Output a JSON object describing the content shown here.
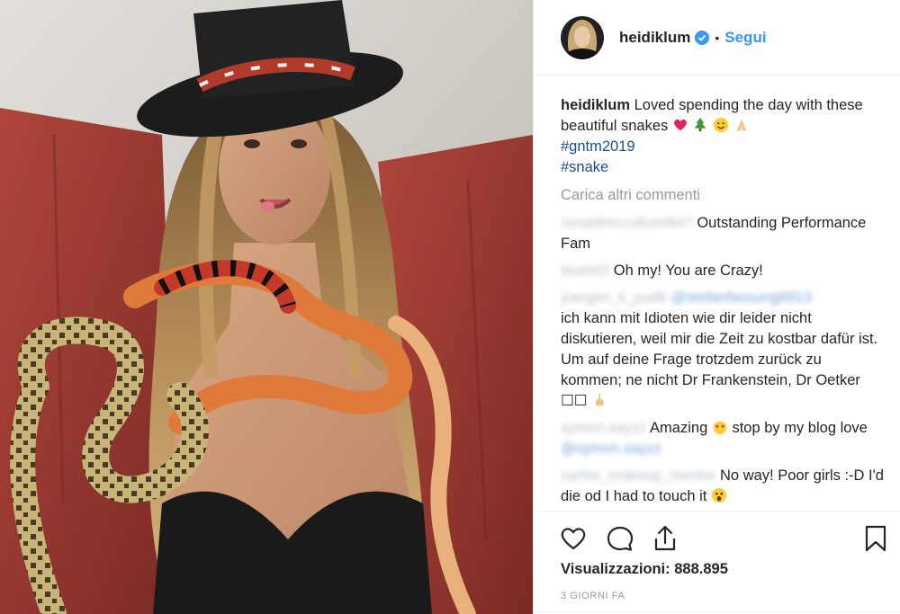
{
  "post": {
    "image": {
      "description_icon": "photo-woman-top-hat-snakes"
    },
    "header": {
      "username": "heidiklum",
      "verified_icon": "verified-badge-icon",
      "separator": "•",
      "follow_label": "Segui"
    },
    "caption": {
      "username": "heidiklum",
      "text": "Loved spending the day with these beautiful snakes",
      "emojis": [
        "red-heart",
        "christmas-tree",
        "smiling-face",
        "folded-hands"
      ],
      "hashtags": [
        "#gntm2019",
        "#snake"
      ]
    },
    "load_more_label": "Carica altri commenti",
    "comments": [
      {
        "user": "ronaldmcculluml947",
        "text": "Outstanding Performance Fam"
      },
      {
        "user": "bluet43",
        "text": "Oh my! You are Crazy!"
      },
      {
        "user": "juergen_k_pudlr",
        "mention": "@stefanfassung8913",
        "text": "ich kann mit Idioten wie dir leider nicht diskutieren, weil mir die Zeit zu kostbar dafür ist. Um auf deine Frage trotzdem zurück zu kommen; ne nicht Dr Frankenstein, Dr Oetker",
        "trailing": "☐☐"
      },
      {
        "user": "symon.sayzz",
        "text": "Amazing",
        "text2": "stop by my blog love",
        "mention": "@symon.sayzz"
      },
      {
        "user": "carlos_makeup_mentor",
        "text": "No way! Poor girls :-D I'd die od I had to touch it"
      }
    ],
    "actions": {
      "like_icon": "heart-icon",
      "comment_icon": "comment-bubble-icon",
      "share_icon": "share-icon",
      "save_icon": "bookmark-icon"
    },
    "views_label": "Visualizzazioni:",
    "views_count": "888.895",
    "timestamp": "3 GIORNI FA"
  },
  "colors": {
    "link": "#3897f0",
    "hashtag": "#1a4f8f",
    "muted": "#999999",
    "text": "#262626"
  }
}
